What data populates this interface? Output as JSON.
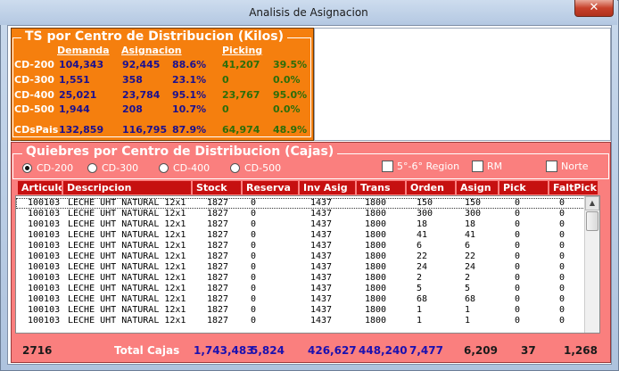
{
  "window": {
    "title": "Analisis de Asignacion",
    "close_glyph": "✕"
  },
  "summary": {
    "title": "TS por Centro de Distribucion (Kilos)",
    "headers": {
      "demanda": "Demanda",
      "asignacion": "Asignacion",
      "picking": "Picking"
    },
    "rows": [
      {
        "label": "CD-200",
        "demanda": "104,343",
        "asig": "92,445",
        "asig_pct": "88.6%",
        "picking": "41,207",
        "pick_pct": "39.5%"
      },
      {
        "label": "CD-300",
        "demanda": "1,551",
        "asig": "358",
        "asig_pct": "23.1%",
        "picking": "0",
        "pick_pct": "0.0%"
      },
      {
        "label": "CD-400",
        "demanda": "25,021",
        "asig": "23,784",
        "asig_pct": "95.1%",
        "picking": "23,767",
        "pick_pct": "95.0%"
      },
      {
        "label": "CD-500",
        "demanda": "1,944",
        "asig": "208",
        "asig_pct": "10.7%",
        "picking": "0",
        "pick_pct": "0.0%"
      },
      {
        "label": "CDsPais",
        "demanda": "132,859",
        "asig": "116,795",
        "asig_pct": "87.9%",
        "picking": "64,974",
        "pick_pct": "48.9%"
      }
    ]
  },
  "section": {
    "title": "Quiebres por Centro de Distribucion (Cajas)",
    "radios": [
      {
        "label": "CD-200",
        "selected": true
      },
      {
        "label": "CD-300",
        "selected": false
      },
      {
        "label": "CD-400",
        "selected": false
      },
      {
        "label": "CD-500",
        "selected": false
      }
    ],
    "checkboxes": [
      {
        "label": "5°-6° Region",
        "checked": false
      },
      {
        "label": "RM",
        "checked": false
      },
      {
        "label": "Norte",
        "checked": false
      }
    ]
  },
  "grid": {
    "columns": [
      "Articulo",
      "Descripcion",
      "Stock",
      "Reserva",
      "Inv Asig",
      "Trans",
      "Orden",
      "Asign",
      "Pick",
      "FaltPick"
    ],
    "rows": [
      [
        "100103",
        "LECHE UHT NATURAL 12x1",
        "1827",
        "0",
        "1437",
        "1800",
        "150",
        "150",
        "0",
        "0"
      ],
      [
        "100103",
        "LECHE UHT NATURAL 12x1",
        "1827",
        "0",
        "1437",
        "1800",
        "300",
        "300",
        "0",
        "0"
      ],
      [
        "100103",
        "LECHE UHT NATURAL 12x1",
        "1827",
        "0",
        "1437",
        "1800",
        "18",
        "18",
        "0",
        "0"
      ],
      [
        "100103",
        "LECHE UHT NATURAL 12x1",
        "1827",
        "0",
        "1437",
        "1800",
        "41",
        "41",
        "0",
        "0"
      ],
      [
        "100103",
        "LECHE UHT NATURAL 12x1",
        "1827",
        "0",
        "1437",
        "1800",
        "6",
        "6",
        "0",
        "0"
      ],
      [
        "100103",
        "LECHE UHT NATURAL 12x1",
        "1827",
        "0",
        "1437",
        "1800",
        "22",
        "22",
        "0",
        "0"
      ],
      [
        "100103",
        "LECHE UHT NATURAL 12x1",
        "1827",
        "0",
        "1437",
        "1800",
        "24",
        "24",
        "0",
        "0"
      ],
      [
        "100103",
        "LECHE UHT NATURAL 12x1",
        "1827",
        "0",
        "1437",
        "1800",
        "2",
        "2",
        "0",
        "0"
      ],
      [
        "100103",
        "LECHE UHT NATURAL 12x1",
        "1827",
        "0",
        "1437",
        "1800",
        "5",
        "5",
        "0",
        "0"
      ],
      [
        "100103",
        "LECHE UHT NATURAL 12x1",
        "1827",
        "0",
        "1437",
        "1800",
        "68",
        "68",
        "0",
        "0"
      ],
      [
        "100103",
        "LECHE UHT NATURAL 12x1",
        "1827",
        "0",
        "1437",
        "1800",
        "1",
        "1",
        "0",
        "0"
      ],
      [
        "100103",
        "LECHE UHT NATURAL 12x1",
        "1827",
        "0",
        "1437",
        "1800",
        "1",
        "1",
        "0",
        "0"
      ]
    ]
  },
  "totals": {
    "count": "2716",
    "label": "Total Cajas",
    "stock": "1,743,483",
    "reserva": "5,824",
    "inv_asig": "426,627",
    "trans": "448,240",
    "orden": "7,477",
    "asign": "6,209",
    "pick": "37",
    "faltpick": "1,268"
  },
  "colors": {
    "summary_bg": "#f57f0e",
    "section_bg": "#fa7f7e",
    "header_bg": "#c61010",
    "value_navy": "#1a1090",
    "value_green": "#2c6e0a"
  },
  "icons": {
    "radio": "radio-icon",
    "checkbox": "checkbox-icon",
    "close": "close-icon",
    "scroll_up": "chevron-up-icon",
    "scroll_down": "chevron-down-icon"
  }
}
